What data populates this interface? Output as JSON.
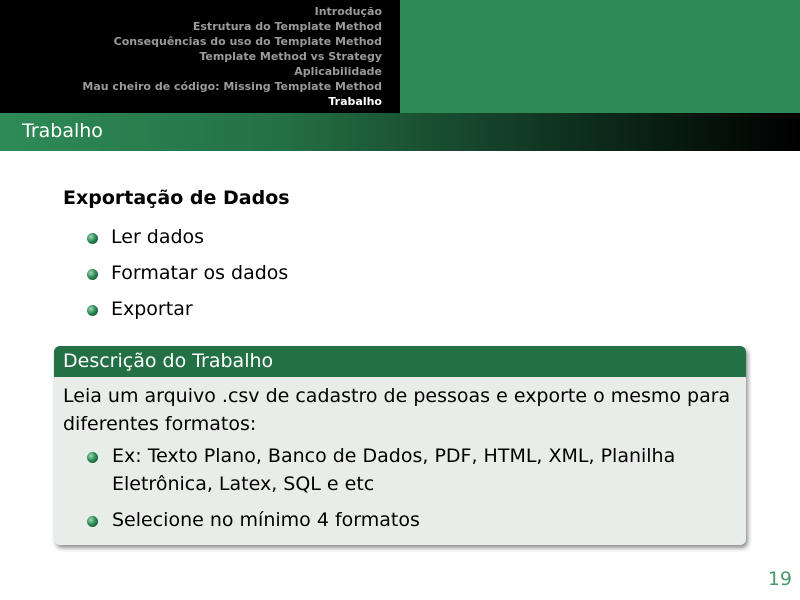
{
  "nav": {
    "items": [
      {
        "label": "Introdução",
        "active": false
      },
      {
        "label": "Estrutura do Template Method",
        "active": false
      },
      {
        "label": "Consequências do uso do Template Method",
        "active": false
      },
      {
        "label": "Template Method vs Strategy",
        "active": false
      },
      {
        "label": "Aplicabilidade",
        "active": false
      },
      {
        "label": "Mau cheiro de código: Missing Template Method",
        "active": false
      },
      {
        "label": "Trabalho",
        "active": true
      }
    ]
  },
  "frame": {
    "title": "Trabalho"
  },
  "content": {
    "heading": "Exportação de Dados",
    "bullets": [
      "Ler dados",
      "Formatar os dados",
      "Exportar"
    ]
  },
  "block": {
    "title": "Descrição do Trabalho",
    "text": "Leia um arquivo .csv de cadastro de pessoas e exporte o mesmo para diferentes formatos:",
    "bullets": [
      "Ex: Texto Plano, Banco de Dados, PDF, HTML, XML, Planilha Eletrônica, Latex, SQL e etc",
      "Selecione no mínimo 4 formatos"
    ]
  },
  "page_number": "19",
  "colors": {
    "accent": "#2e8b57",
    "block_title": "#247045",
    "block_body": "#e9ede9",
    "nav_inactive": "#9a9a9a",
    "nav_active": "#ffffff"
  }
}
